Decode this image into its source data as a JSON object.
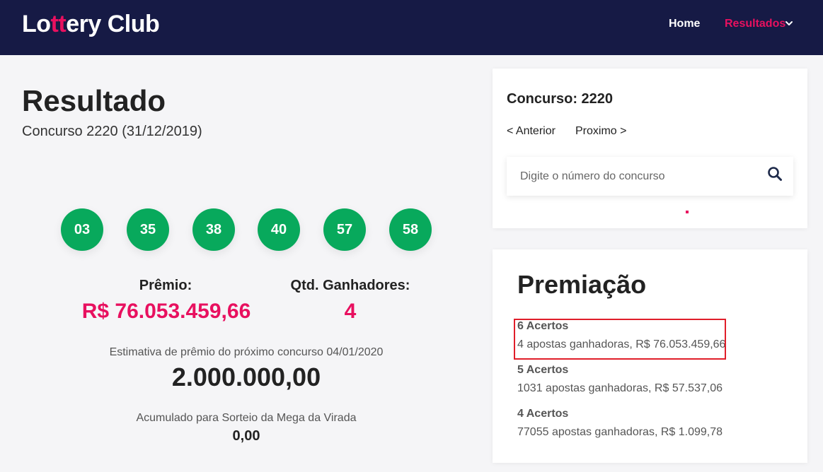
{
  "nav": {
    "logo_pre": "Lo",
    "logo_accent": "tt",
    "logo_post": "ery Club",
    "home": "Home",
    "results": "Resultados",
    "accent_color": "#e8105f",
    "bg_color": "#161a45"
  },
  "result": {
    "title": "Resultado",
    "subtitle": "Concurso 2220 (31/12/2019)",
    "numbers": [
      "03",
      "35",
      "38",
      "40",
      "57",
      "58"
    ],
    "ball_color": "#08a95c",
    "prize_label": "Prêmio:",
    "prize_value": "R$ 76.053.459,66",
    "winners_label": "Qtd. Ganhadores:",
    "winners_value": "4",
    "estimate_label": "Estimativa de prêmio do próximo concurso 04/01/2020",
    "estimate_value": "2.000.000,00",
    "accum_label": "Acumulado para Sorteio da Mega da Virada",
    "accum_value": "0,00"
  },
  "sidebar": {
    "contest_title": "Concurso: 2220",
    "prev": "< Anterior",
    "next": "Proximo >",
    "search_placeholder": "Digite o número do concurso",
    "search_icon": "search-icon"
  },
  "prizes": {
    "title": "Premiação",
    "tiers": [
      {
        "name": "6 Acertos",
        "desc": "4 apostas ganhadoras, R$ 76.053.459,66"
      },
      {
        "name": "5 Acertos",
        "desc": "1031 apostas ganhadoras, R$ 57.537,06"
      },
      {
        "name": "4 Acertos",
        "desc": "77055 apostas ganhadoras, R$ 1.099,78"
      }
    ]
  }
}
